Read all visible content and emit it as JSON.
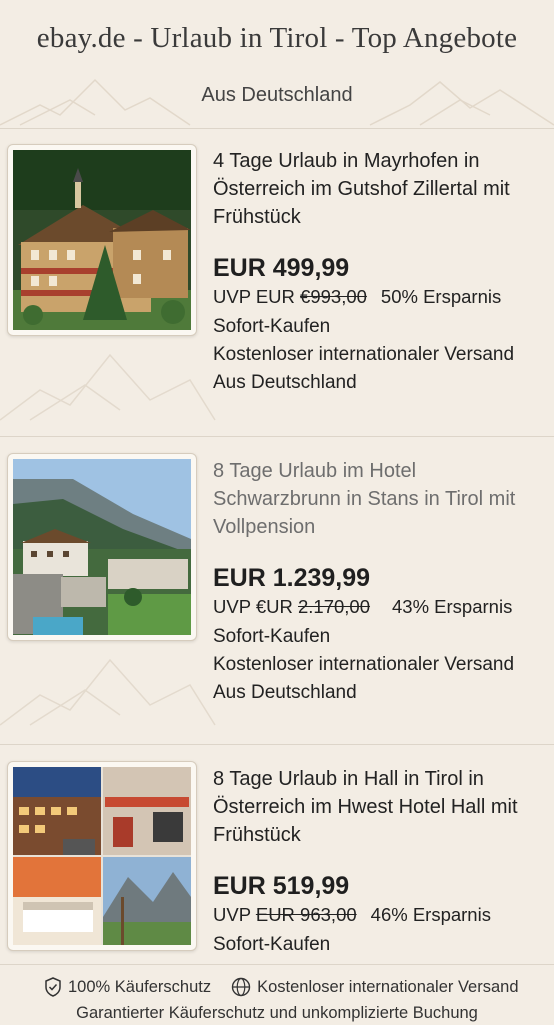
{
  "header": {
    "title": "ebay.de - Urlaub in Tirol - Top Angebote",
    "subtitle": "Aus Deutschland"
  },
  "listings": [
    {
      "title": "4 Tage Urlaub in Mayrhofen in Österreich im Gutshof Zillertal mit Frühstück",
      "price": "EUR 499,99",
      "uvp_prefix": "UVP EUR ",
      "uvp_old": "€993,00",
      "savings": "50% Ersparnis",
      "buy_type": "Sofort-Kaufen",
      "shipping": "Kostenloser internationaler Versand",
      "origin": "Aus Deutschland",
      "image_icon": "chalet-hotel-image"
    },
    {
      "title": "8 Tage Urlaub im Hotel Schwarzbrunn in Stans in Tirol mit Vollpension",
      "price": "EUR 1.239,99",
      "uvp_prefix": "UVP €UR ",
      "uvp_old": "2.170,00",
      "savings": "43% Ersparnis",
      "buy_type": "Sofort-Kaufen",
      "shipping": "Kostenloser internationaler Versand",
      "origin": "Aus Deutschland",
      "image_icon": "valley-hotel-image"
    },
    {
      "title": "8 Tage Urlaub in Hall in Tirol in Österreich im Hwest Hotel Hall mit Frühstück",
      "price": "EUR 519,99",
      "uvp_prefix": "UVP ",
      "uvp_old": "EUR 963,00",
      "savings": "46% Ersparnis",
      "buy_type": "Sofort-Kaufen",
      "image_icon": "hotel-collage-image"
    }
  ],
  "footer": {
    "protection": "100% Käuferschutz",
    "shipping": "Kostenloser internationaler Versand",
    "tagline": "Garantierter Käuferschutz und unkomplizierte Buchung"
  },
  "colors": {
    "background": "#f3ede4",
    "divider": "#ddd5c9",
    "text": "#1f1f1f"
  }
}
